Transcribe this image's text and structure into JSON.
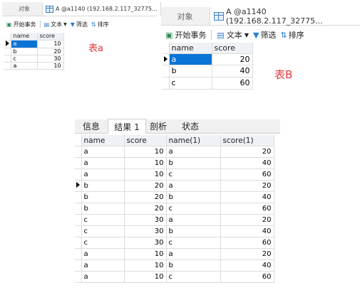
{
  "tableA": {
    "tab_object": "对象",
    "tab_query": "A @a1140 (192.168.2.117_32775...",
    "toolbar": {
      "begin": "开始事务",
      "text": "文本",
      "filter": "筛选",
      "sort": "排序"
    },
    "columns": [
      "name",
      "score"
    ],
    "rows": [
      [
        "a",
        "10"
      ],
      [
        "b",
        "20"
      ],
      [
        "c",
        "30"
      ],
      [
        "a",
        "10"
      ]
    ],
    "caption": "表a"
  },
  "tableB": {
    "tab_object": "对象",
    "tab_query": "A @a1140 (192.168.2.117_32775...",
    "toolbar": {
      "begin": "开始事务",
      "text": "文本",
      "filter": "筛选",
      "sort": "排序"
    },
    "columns": [
      "name",
      "score"
    ],
    "rows": [
      [
        "a",
        "20"
      ],
      [
        "b",
        "40"
      ],
      [
        "c",
        "60"
      ]
    ],
    "caption": "表B"
  },
  "result": {
    "tabs": [
      "信息",
      "结果 1",
      "剖析",
      "状态"
    ],
    "columns": [
      "name",
      "score",
      "name(1)",
      "score(1)"
    ],
    "rows": [
      [
        "a",
        "10",
        "a",
        "20"
      ],
      [
        "a",
        "10",
        "b",
        "40"
      ],
      [
        "a",
        "10",
        "c",
        "60"
      ],
      [
        "b",
        "20",
        "a",
        "20"
      ],
      [
        "b",
        "20",
        "b",
        "40"
      ],
      [
        "b",
        "20",
        "c",
        "60"
      ],
      [
        "c",
        "30",
        "a",
        "20"
      ],
      [
        "c",
        "30",
        "b",
        "40"
      ],
      [
        "c",
        "30",
        "c",
        "60"
      ],
      [
        "a",
        "10",
        "a",
        "20"
      ],
      [
        "a",
        "10",
        "b",
        "40"
      ],
      [
        "a",
        "10",
        "c",
        "60"
      ]
    ]
  }
}
